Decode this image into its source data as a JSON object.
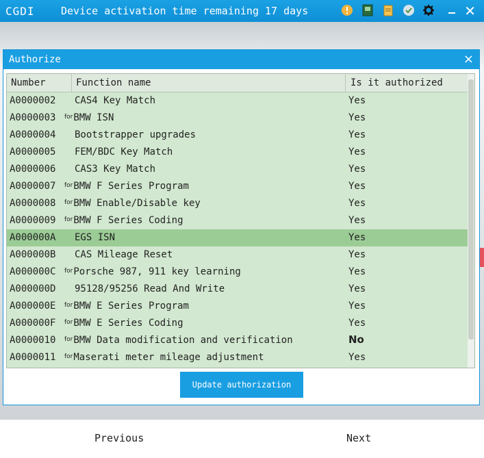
{
  "app": {
    "name": "CGDI",
    "activation_text": "Device activation time remaining 17 days",
    "icons": [
      "alert-icon",
      "device-icon",
      "document-icon",
      "settings-shield-icon",
      "gear-icon",
      "close-icon"
    ],
    "accent_color": "#1a9ee2"
  },
  "dialog": {
    "title": "Authorize",
    "close_label": "×",
    "columns": {
      "number": "Number",
      "function": "Function name",
      "authorized": "Is it authorized"
    },
    "rows": [
      {
        "number": "A0000002",
        "for": "",
        "name": "CAS4 Key Match",
        "authorized": "Yes"
      },
      {
        "number": "A0000003",
        "for": "for",
        "name": "BMW ISN",
        "authorized": "Yes"
      },
      {
        "number": "A0000004",
        "for": "",
        "name": "Bootstrapper upgrades",
        "authorized": "Yes"
      },
      {
        "number": "A0000005",
        "for": "",
        "name": "FEM/BDC Key Match",
        "authorized": "Yes"
      },
      {
        "number": "A0000006",
        "for": "",
        "name": "CAS3 Key Match",
        "authorized": "Yes"
      },
      {
        "number": "A0000007",
        "for": "for",
        "name": "BMW F Series Program",
        "authorized": "Yes"
      },
      {
        "number": "A0000008",
        "for": "for",
        "name": "BMW Enable/Disable key",
        "authorized": "Yes"
      },
      {
        "number": "A0000009",
        "for": "for",
        "name": "BMW F Series Coding",
        "authorized": "Yes"
      },
      {
        "number": "A000000A",
        "for": "",
        "name": "EGS ISN",
        "authorized": "Yes",
        "selected": true
      },
      {
        "number": "A000000B",
        "for": "",
        "name": "CAS Mileage Reset",
        "authorized": "Yes"
      },
      {
        "number": "A000000C",
        "for": "for",
        "name": "Porsche 987, 911 key learning",
        "authorized": "Yes"
      },
      {
        "number": "A000000D",
        "for": "",
        "name": "95128/95256 Read And Write",
        "authorized": "Yes"
      },
      {
        "number": "A000000E",
        "for": "for",
        "name": "BMW E Series Program",
        "authorized": "Yes"
      },
      {
        "number": "A000000F",
        "for": "for",
        "name": "BMW E Series Coding",
        "authorized": "Yes"
      },
      {
        "number": "A0000010",
        "for": "for",
        "name": "BMW Data modification and verification",
        "authorized": "No",
        "bold": true
      },
      {
        "number": "A0000011",
        "for": "for",
        "name": "Maserati meter mileage adjustment",
        "authorized": "Yes"
      }
    ],
    "update_button": "Update authorization"
  },
  "footer": {
    "previous": "Previous",
    "next": "Next"
  }
}
